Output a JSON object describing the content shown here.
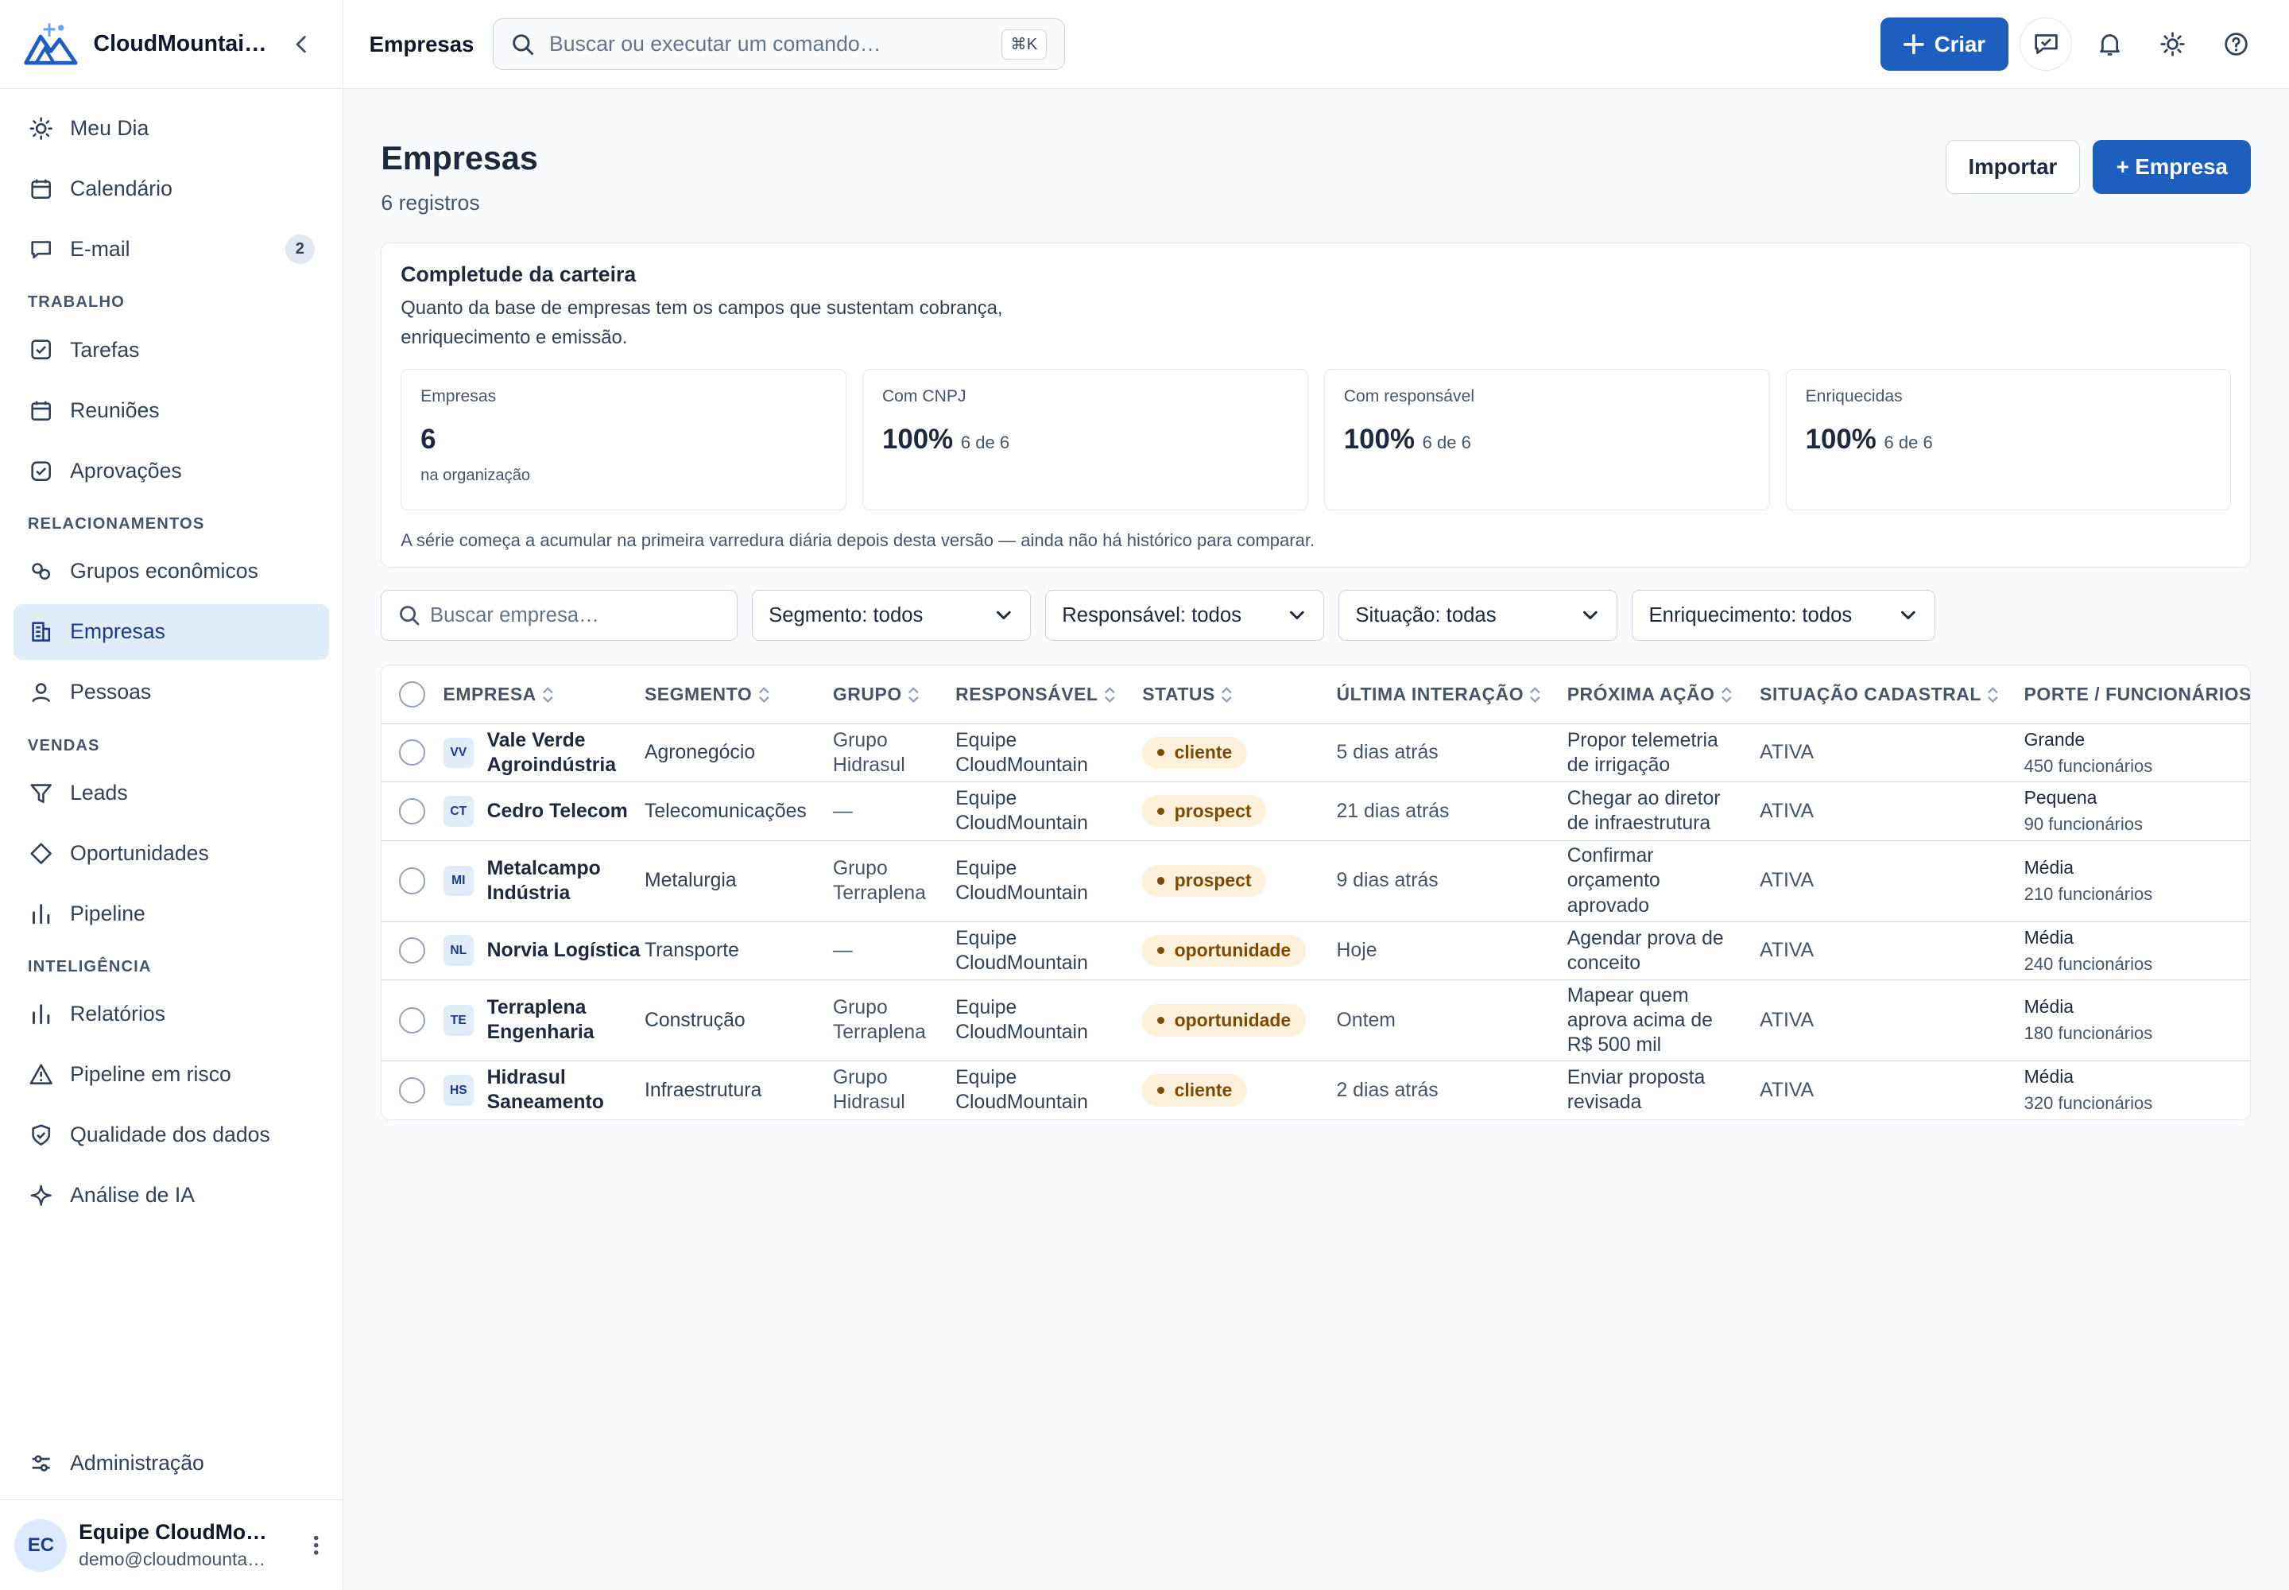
{
  "brand": {
    "name": "CloudMountai…"
  },
  "sidebar": {
    "primary": [
      {
        "label": "Meu Dia",
        "icon": "sun-icon"
      },
      {
        "label": "Calendário",
        "icon": "calendar-icon"
      },
      {
        "label": "E-mail",
        "icon": "message-icon",
        "badge": "2"
      }
    ],
    "sections": [
      {
        "title": "TRABALHO",
        "items": [
          {
            "label": "Tarefas",
            "icon": "checkbox-icon"
          },
          {
            "label": "Reuniões",
            "icon": "calendar-icon"
          },
          {
            "label": "Aprovações",
            "icon": "check-square-icon"
          }
        ]
      },
      {
        "title": "RELACIONAMENTOS",
        "items": [
          {
            "label": "Grupos econômicos",
            "icon": "link-icon"
          },
          {
            "label": "Empresas",
            "icon": "building-icon",
            "active": true
          },
          {
            "label": "Pessoas",
            "icon": "user-icon"
          }
        ]
      },
      {
        "title": "VENDAS",
        "items": [
          {
            "label": "Leads",
            "icon": "filter-icon"
          },
          {
            "label": "Oportunidades",
            "icon": "diamond-icon"
          },
          {
            "label": "Pipeline",
            "icon": "bars-icon"
          }
        ]
      },
      {
        "title": "INTELIGÊNCIA",
        "items": [
          {
            "label": "Relatórios",
            "icon": "bars-icon"
          },
          {
            "label": "Pipeline em risco",
            "icon": "warning-icon"
          },
          {
            "label": "Qualidade dos dados",
            "icon": "shield-check-icon"
          },
          {
            "label": "Análise de IA",
            "icon": "sparkle-icon"
          }
        ]
      }
    ],
    "admin": {
      "label": "Administração",
      "icon": "sliders-icon"
    },
    "user": {
      "initials": "EC",
      "name": "Equipe CloudMo…",
      "email": "demo@cloudmounta…"
    }
  },
  "topbar": {
    "title": "Empresas",
    "search_placeholder": "Buscar ou executar um comando…",
    "shortcut": "⌘K",
    "create_label": "Criar"
  },
  "page": {
    "title": "Empresas",
    "subtitle": "6 registros",
    "import_label": "Importar",
    "add_label": "+ Empresa"
  },
  "completeness": {
    "title": "Completude da carteira",
    "description": "Quanto da base de empresas tem os campos que sustentam cobrança, enriquecimento e emissão.",
    "metrics": [
      {
        "label": "Empresas",
        "value": "6",
        "of": "",
        "note": "na organização"
      },
      {
        "label": "Com CNPJ",
        "value": "100%",
        "of": "6 de 6",
        "note": ""
      },
      {
        "label": "Com responsável",
        "value": "100%",
        "of": "6 de 6",
        "note": ""
      },
      {
        "label": "Enriquecidas",
        "value": "100%",
        "of": "6 de 6",
        "note": ""
      }
    ],
    "footer": "A série começa a acumular na primeira varredura diária depois desta versão — ainda não há histórico para comparar."
  },
  "filters": {
    "search_placeholder": "Buscar empresa…",
    "selects": [
      "Segmento: todos",
      "Responsável: todos",
      "Situação: todas",
      "Enriquecimento: todos"
    ]
  },
  "table": {
    "columns": [
      "EMPRESA",
      "SEGMENTO",
      "GRUPO",
      "RESPONSÁVEL",
      "STATUS",
      "ÚLTIMA INTERAÇÃO",
      "PRÓXIMA AÇÃO",
      "SITUAÇÃO CADASTRAL",
      "PORTE / FUNCIONÁRIOS"
    ],
    "rows": [
      {
        "initials": "VV",
        "name": "Vale Verde Agroindústria",
        "segment": "Agronegócio",
        "group": "Grupo Hidrasul",
        "owner": "Equipe CloudMountain",
        "status": "cliente",
        "last": "5 dias atrás",
        "next": "Propor telemetria de irrigação",
        "situation": "ATIVA",
        "size": "Grande",
        "employees": "450 funcionários"
      },
      {
        "initials": "CT",
        "name": "Cedro Telecom",
        "segment": "Telecomunicações",
        "group": "—",
        "owner": "Equipe CloudMountain",
        "status": "prospect",
        "last": "21 dias atrás",
        "next": "Chegar ao diretor de infraestrutura",
        "situation": "ATIVA",
        "size": "Pequena",
        "employees": "90 funcionários"
      },
      {
        "initials": "MI",
        "name": "Metalcampo Indústria",
        "segment": "Metalurgia",
        "group": "Grupo Terraplena",
        "owner": "Equipe CloudMountain",
        "status": "prospect",
        "last": "9 dias atrás",
        "next": "Confirmar orçamento aprovado",
        "situation": "ATIVA",
        "size": "Média",
        "employees": "210 funcionários"
      },
      {
        "initials": "NL",
        "name": "Norvia Logística",
        "segment": "Transporte",
        "group": "—",
        "owner": "Equipe CloudMountain",
        "status": "oportunidade",
        "last": "Hoje",
        "next": "Agendar prova de conceito",
        "situation": "ATIVA",
        "size": "Média",
        "employees": "240 funcionários"
      },
      {
        "initials": "TE",
        "name": "Terraplena Engenharia",
        "segment": "Construção",
        "group": "Grupo Terraplena",
        "owner": "Equipe CloudMountain",
        "status": "oportunidade",
        "last": "Ontem",
        "next": "Mapear quem aprova acima de R$ 500 mil",
        "situation": "ATIVA",
        "size": "Média",
        "employees": "180 funcionários"
      },
      {
        "initials": "HS",
        "name": "Hidrasul Saneamento",
        "segment": "Infraestrutura",
        "group": "Grupo Hidrasul",
        "owner": "Equipe CloudMountain",
        "status": "cliente",
        "last": "2 dias atrás",
        "next": "Enviar proposta revisada",
        "situation": "ATIVA",
        "size": "Média",
        "employees": "320 funcionários"
      }
    ]
  },
  "colors": {
    "primary": "#1d5fbf",
    "status_bg": "#fdf1dc",
    "status_fg": "#7c4a03",
    "active_nav": "#e0ecf7"
  }
}
